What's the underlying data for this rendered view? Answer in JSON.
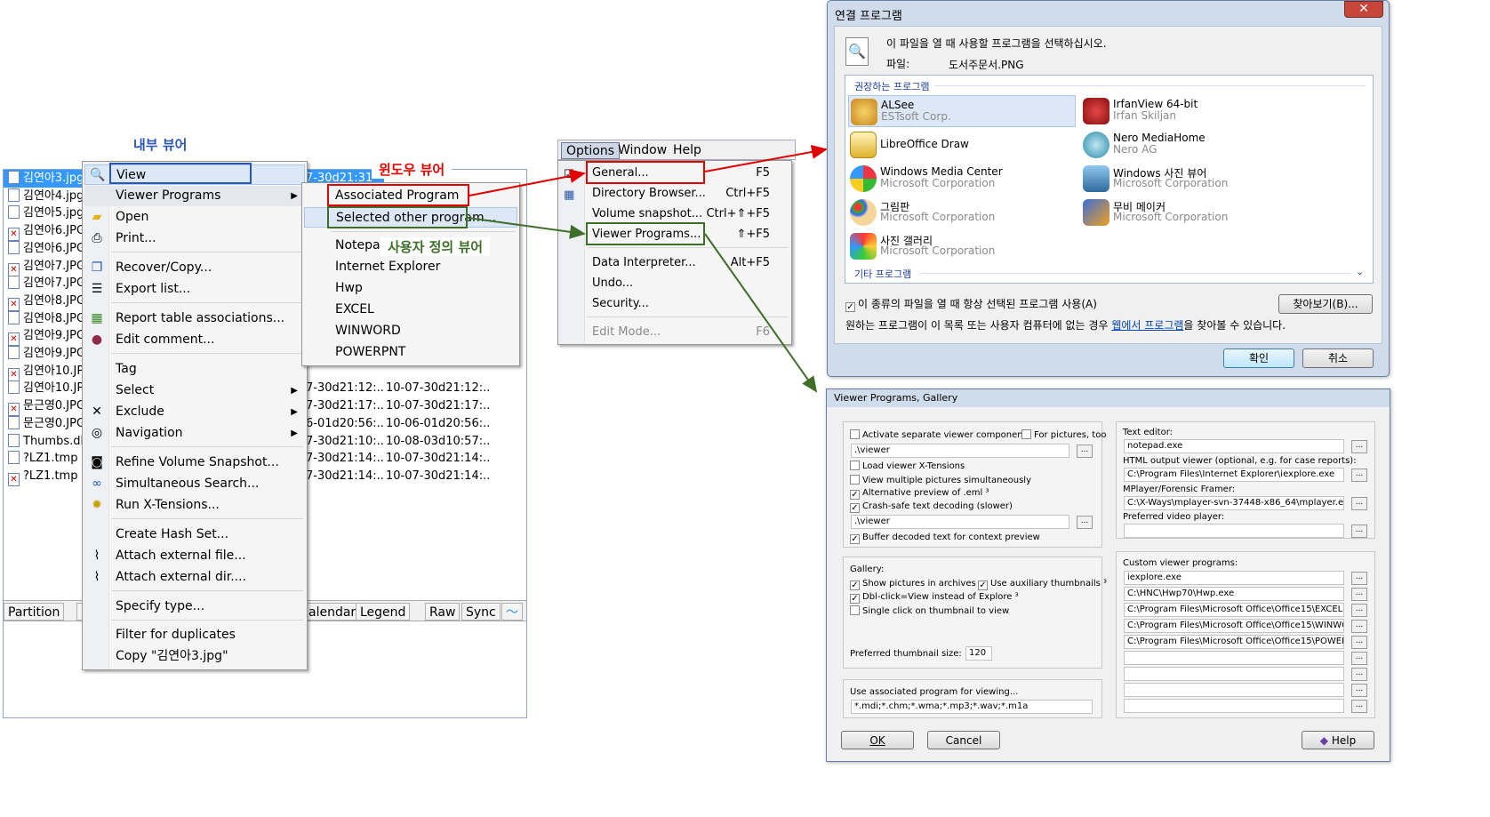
{
  "annotations": {
    "internal_viewer": "내부 뷰어",
    "windows_viewer": "윈도우 뷰어",
    "custom_viewer": "사용자 정의 뷰어"
  },
  "colors": {
    "internal": "#2b56b8",
    "windows": "#e00000",
    "custom": "#3f6e2a"
  },
  "files": [
    {
      "name": "김연아3.jpg",
      "d1": "7-30d21:31",
      "d2": "",
      "selected": true
    },
    {
      "name": "김연아4.jpg",
      "d1": "",
      "d2": ""
    },
    {
      "name": "김연아5.jpg",
      "d1": "",
      "d2": ""
    },
    {
      "name": "김연아6.JPG",
      "d1": "",
      "d2": ""
    },
    {
      "name": "김연아6.JPG",
      "d1": "",
      "d2": ""
    },
    {
      "name": "김연아7.JPG",
      "d1": "",
      "d2": ""
    },
    {
      "name": "김연아7.JPG",
      "d1": "",
      "d2": ""
    },
    {
      "name": "김연아8.JPG",
      "d1": "",
      "d2": ""
    },
    {
      "name": "김연아8.JPG",
      "d1": "",
      "d2": ""
    },
    {
      "name": "김연아9.JPG",
      "d1": "",
      "d2": ""
    },
    {
      "name": "김연아9.JPG",
      "d1": "",
      "d2": ""
    },
    {
      "name": "김연아10.JPG",
      "d1": "",
      "d2": ""
    },
    {
      "name": "김연아10.JPG",
      "d1": "7-30d21:12:...",
      "d2": "10-07-30d21:12:..."
    },
    {
      "name": "문근영0.JPG",
      "d1": "7-30d21:17:...",
      "d2": "10-07-30d21:17:..."
    },
    {
      "name": "문근영0.JPG",
      "d1": "6-01d20:56:...",
      "d2": "10-06-01d20:56:..."
    },
    {
      "name": "Thumbs.db",
      "d1": "7-30d21:10:...",
      "d2": "10-08-03d10:57:..."
    },
    {
      "name": "?LZ1.tmp",
      "d1": "7-30d21:14:...",
      "d2": "10-07-30d21:14:..."
    },
    {
      "name": "?LZ1.tmp",
      "d1": "7-30d21:14:...",
      "d2": "10-07-30d21:14:..."
    }
  ],
  "bottom_tabs": [
    "Partition",
    "F",
    "alendar",
    "Legend",
    "Raw",
    "Sync"
  ],
  "context_menu": {
    "view": "View",
    "viewer_programs": "Viewer Programs",
    "open": "Open",
    "print": "Print...",
    "recover": "Recover/Copy...",
    "export": "Export list...",
    "report": "Report table associations...",
    "edit_comment": "Edit comment...",
    "tag": "Tag",
    "select": "Select",
    "exclude": "Exclude",
    "navigation": "Navigation",
    "refine": "Refine Volume Snapshot...",
    "sim_search": "Simultaneous Search...",
    "run_xt": "Run X-Tensions...",
    "hash": "Create Hash Set...",
    "attach_file": "Attach external file...",
    "attach_dir": "Attach external dir....",
    "specify": "Specify type...",
    "dupes": "Filter for duplicates",
    "copy": "Copy \"김연아3.jpg\""
  },
  "submenu": {
    "associated": "Associated Program",
    "selected_other": "Selected other program...",
    "items": [
      "Notepad",
      "Internet Explorer",
      "Hwp",
      "EXCEL",
      "WINWORD",
      "POWERPNT"
    ]
  },
  "menubar": [
    "Options",
    "Window",
    "Help"
  ],
  "options_menu": [
    {
      "label": "General...",
      "shortcut": "F5"
    },
    {
      "label": "Directory Browser...",
      "shortcut": "Ctrl+F5"
    },
    {
      "label": "Volume snapshot...",
      "shortcut": "Ctrl+⇑+F5"
    },
    {
      "label": "Viewer Programs...",
      "shortcut": "⇑+F5"
    },
    {
      "label": "Data Interpreter...",
      "shortcut": "Alt+F5"
    },
    {
      "label": "Undo...",
      "shortcut": ""
    },
    {
      "label": "Security...",
      "shortcut": ""
    },
    {
      "label": "Edit Mode...",
      "shortcut": "F6"
    }
  ],
  "open_with": {
    "title": "연결 프로그램",
    "close": "✕",
    "instruction": "이 파일을 열 때 사용할 프로그램을 선택하십시오.",
    "file_label": "파일:",
    "file_name": "도서주문서.PNG",
    "recommended": "권장하는 프로그램",
    "programs": [
      {
        "name": "ALSee",
        "company": "ESTsoft Corp."
      },
      {
        "name": "IrfanView 64-bit",
        "company": "Irfan Skiljan"
      },
      {
        "name": "LibreOffice Draw",
        "company": ""
      },
      {
        "name": "Nero MediaHome",
        "company": "Nero AG"
      },
      {
        "name": "Windows Media Center",
        "company": "Microsoft Corporation"
      },
      {
        "name": "Windows 사진 뷰어",
        "company": "Microsoft Corporation"
      },
      {
        "name": "그림판",
        "company": "Microsoft Corporation"
      },
      {
        "name": "무비 메이커",
        "company": "Microsoft Corporation"
      },
      {
        "name": "사진 갤러리",
        "company": "Microsoft Corporation"
      }
    ],
    "other": "기타 프로그램",
    "always": "이 종류의 파일을 열 때 항상 선택된 프로그램 사용(A)",
    "browse": "찾아보기(B)...",
    "web_note_a": "원하는 프로그램이 이 목록 또는 사용자 컴퓨터에 없는 경우",
    "web_link": "웹에서 프로그램",
    "web_note_b": "을 찾아볼 수 있습니다.",
    "ok": "확인",
    "cancel": "취소"
  },
  "gallery": {
    "title": "Viewer Programs, Gallery",
    "activate": "Activate separate viewer component",
    "for_pictures": "For pictures, too",
    "viewer_path": ".\\viewer",
    "load_xt": "Load viewer X-Tensions",
    "multi": "View multiple pictures simultaneously",
    "alt_eml": "Alternative preview of .eml ³",
    "crash_safe": "Crash-safe text decoding (slower)",
    "viewer_path2": ".\\viewer",
    "buffer": "Buffer decoded text for context preview",
    "gallery_label": "Gallery:",
    "show_archives": "Show pictures in archives",
    "aux_thumbs": "Use auxiliary thumbnails ³",
    "dblclick": "Dbl-click=View instead of Explore ³",
    "single": "Single click on thumbnail to view",
    "thumb_size_label": "Preferred thumbnail size:",
    "thumb_size": "120",
    "assoc_label": "Use associated program for viewing...",
    "assoc_value": "*.mdi;*.chm;*.wma;*.mp3;*.wav;*.m1a",
    "text_editor_label": "Text editor:",
    "text_editor": "notepad.exe",
    "html_label": "HTML output viewer (optional, e.g. for case reports):",
    "html_value": "C:\\Program Files\\Internet Explorer\\iexplore.exe",
    "mplayer_label": "MPlayer/Forensic Framer:",
    "mplayer_value": "C:\\X-Ways\\mplayer-svn-37448-x86_64\\mplayer.exe",
    "video_label": "Preferred video player:",
    "video_value": "",
    "custom_label": "Custom viewer programs:",
    "custom": [
      "iexplore.exe",
      "C:\\HNC\\Hwp70\\Hwp.exe",
      "C:\\Program Files\\Microsoft Office\\Office15\\EXCEL.EX",
      "C:\\Program Files\\Microsoft Office\\Office15\\WINWORD",
      "C:\\Program Files\\Microsoft Office\\Office15\\POWERPN",
      "",
      "",
      "",
      ""
    ],
    "ok": "OK",
    "cancel": "Cancel",
    "help": "Help",
    "ellipsis": "..."
  }
}
